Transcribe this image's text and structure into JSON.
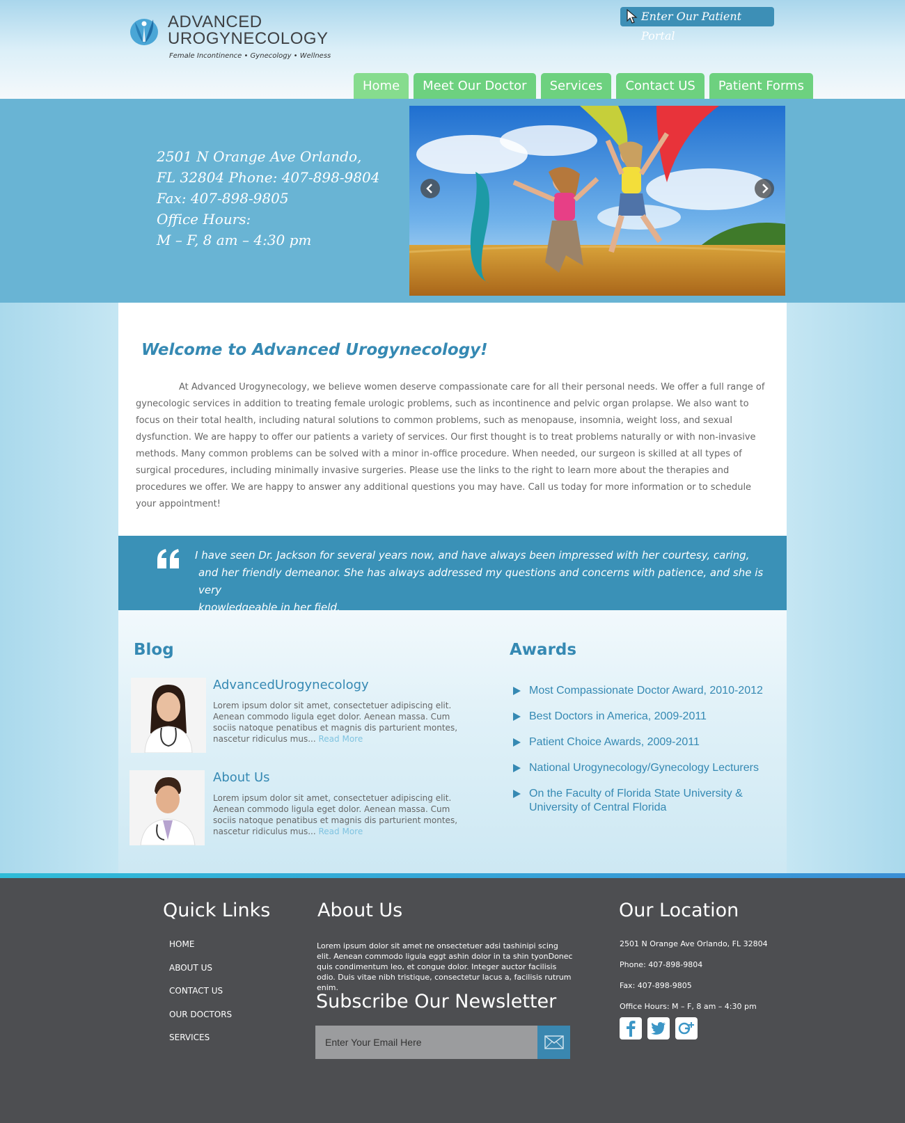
{
  "header": {
    "logo_line1": "ADVANCED",
    "logo_line2": "UROGYNECOLOGY",
    "logo_tagline": "Female Incontinence • Gynecology • Wellness",
    "portal_label": "Enter Our Patient Portal"
  },
  "nav": {
    "items": [
      {
        "label": "Home",
        "active": true
      },
      {
        "label": "Meet Our Doctor"
      },
      {
        "label": "Services"
      },
      {
        "label": "Contact US"
      },
      {
        "label": "Patient Forms"
      }
    ]
  },
  "hero": {
    "address_lines": [
      "2501 N Orange Ave Orlando,",
      "FL 32804 Phone: 407-898-9804",
      "Fax: 407-898-9805",
      "Office Hours:",
      "M – F, 8 am – 4:30 pm"
    ]
  },
  "welcome": {
    "title": "Welcome to Advanced Urogynecology!",
    "body": "At Advanced Urogynecology, we believe women deserve compassionate care for all their personal needs. We offer a full range of gynecologic services in addition to treating female urologic problems, such as incontinence and pelvic organ prolapse. We also want to focus on their total health, including natural solutions to common problems, such as menopause, insomnia, weight loss, and sexual dysfunction. We are happy to offer our patients a variety of services. Our first thought is to treat problems naturally or with non-invasive methods. Many common problems can be solved with a minor in-office procedure. When needed, our surgeon is skilled at all types of surgical procedures, including minimally invasive surgeries. Please use the links to the right to learn more about the therapies and procedures we offer. We are happy to answer any additional questions you may have. Call us today for more information or to schedule your appointment!"
  },
  "testimonial": {
    "line1": "I have seen Dr. Jackson for several years now, and have always been impressed with her courtesy, caring,",
    "line2": "and her friendly demeanor. She has always addressed my questions and concerns with patience, and she is very",
    "line3": "knowledgeable in her field."
  },
  "blog": {
    "title": "Blog",
    "posts": [
      {
        "title": "AdvancedUrogynecology",
        "excerpt": "Lorem ipsum dolor sit amet, consectetuer adipiscing elit. Aenean commodo ligula eget dolor. Aenean massa. Cum sociis natoque penatibus et magnis dis parturient montes, nascetur ridiculus mus...",
        "read_more": "Read More"
      },
      {
        "title": "About Us",
        "excerpt": "Lorem ipsum dolor sit amet, consectetuer adipiscing elit. Aenean commodo ligula eget dolor. Aenean massa. Cum sociis natoque penatibus et magnis dis parturient montes, nascetur ridiculus mus...",
        "read_more": "Read More"
      }
    ]
  },
  "awards": {
    "title": "Awards",
    "items": [
      "Most Compassionate Doctor Award, 2010-2012",
      "Best Doctors in America, 2009-2011",
      "Patient Choice Awards, 2009-2011",
      "National Urogynecology/Gynecology Lecturers",
      "On the Faculty of Florida State University & University of Central Florida"
    ]
  },
  "footer": {
    "quick_links_title": "Quick Links",
    "quick_links": [
      "HOME",
      "ABOUT US",
      "CONTACT US",
      "OUR DOCTORS",
      "SERVICES"
    ],
    "about_title": "About Us",
    "about_text": "Lorem ipsum dolor sit amet ne onsectetuer adsi tashinipi scing elit. Aenean commodo ligula eggt ashin dolor in ta shin tyonDonec quis condimentum leo, et congue dolor. Integer auctor facilisis odio. Duis vitae nibh tristique, consectetur lacus a, facilisis rutrum enim.",
    "newsletter_title": "Subscribe Our Newsletter",
    "email_placeholder": "Enter Your Email Here",
    "location_title": "Our Location",
    "location_lines": [
      "2501 N Orange Ave Orlando, FL 32804",
      "Phone: 407-898-9804",
      "Fax: 407-898-9805",
      "Office Hours: M – F, 8 am – 4:30 pm"
    ],
    "social": [
      "facebook-icon",
      "twitter-icon",
      "google-plus-icon"
    ]
  },
  "colors": {
    "accent_blue": "#3589b3",
    "nav_green": "#6dd17f",
    "hero_blue": "#69b4d4",
    "footer_gray": "#4d4e51"
  }
}
